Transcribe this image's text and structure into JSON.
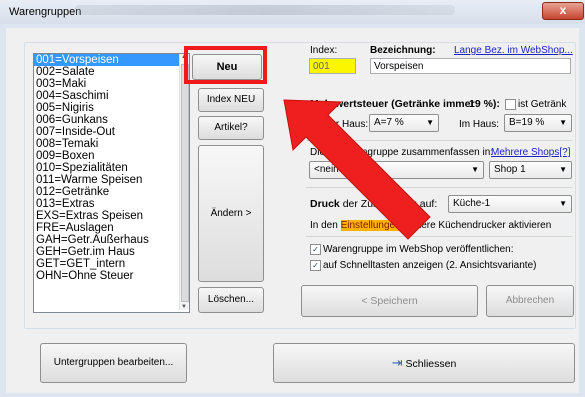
{
  "window": {
    "title": "Warengruppen",
    "close_glyph": "x"
  },
  "list": {
    "items": [
      "001=Vorspeisen",
      "002=Salate",
      "003=Maki",
      "004=Saschimi",
      "005=Nigiris",
      "006=Gunkans",
      "007=Inside-Out",
      "008=Temaki",
      "009=Boxen",
      "010=Spezialitäten",
      "011=Warme Speisen",
      "012=Getränke",
      "013=Extras",
      "EXS=Extras Speisen",
      "FRE=Auslagen",
      "GAH=Getr.Außerhaus",
      "GEH=Getr.im Haus",
      "GET=GET_intern",
      "OHN=Ohne Steuer"
    ],
    "selected_index": 0
  },
  "buttons": {
    "neu": "Neu",
    "index_neu": "Index NEU",
    "artikel": "Artikel?",
    "aendern": "Ändern >",
    "loeschen": "Löschen...",
    "speichern": "< Speichern",
    "abbrechen": "Abbrechen",
    "untergruppen": "Untergruppen bearbeiten...",
    "schliessen": "Schliessen"
  },
  "index": {
    "label": "Index:",
    "value": "001"
  },
  "bezeichnung": {
    "label": "Bezeichnung:",
    "value": "Vorspeisen",
    "link": "Lange Bez. im WebShop..."
  },
  "mwst": {
    "label_left": "Mehrwertsteuer (Getränke immer",
    "label_right": "19 %):",
    "ist_getraenk": "ist Getränk",
    "ausser_haus_label": "Außer Haus:",
    "ausser_haus_value": "A=7 %",
    "im_haus_label": "Im Haus:",
    "im_haus_value": "B=19 %"
  },
  "zusammenfassen": {
    "label": "Diese Warengruppe zusammenfassen in:",
    "value": "<nein>",
    "link": "Mehrere Shops[?]",
    "shop_value": "Shop 1"
  },
  "druck": {
    "label_bold": "Druck",
    "label_rest": "der Zubereitung auf:",
    "value": "Küche-1",
    "info_before": "In den",
    "info_highlight": "Einstellungen",
    "info_after": "weitere Küchendrucker aktivieren"
  },
  "options": {
    "webshop": "Warengruppe im WebShop veröffentlichen:",
    "schnelltasten": "auf Schnelltasten anzeigen (2. Ansichtsvariante)"
  },
  "colors": {
    "annotation": "#ef1a1a",
    "selection": "#3399ff",
    "index_field": "#fcf700"
  }
}
